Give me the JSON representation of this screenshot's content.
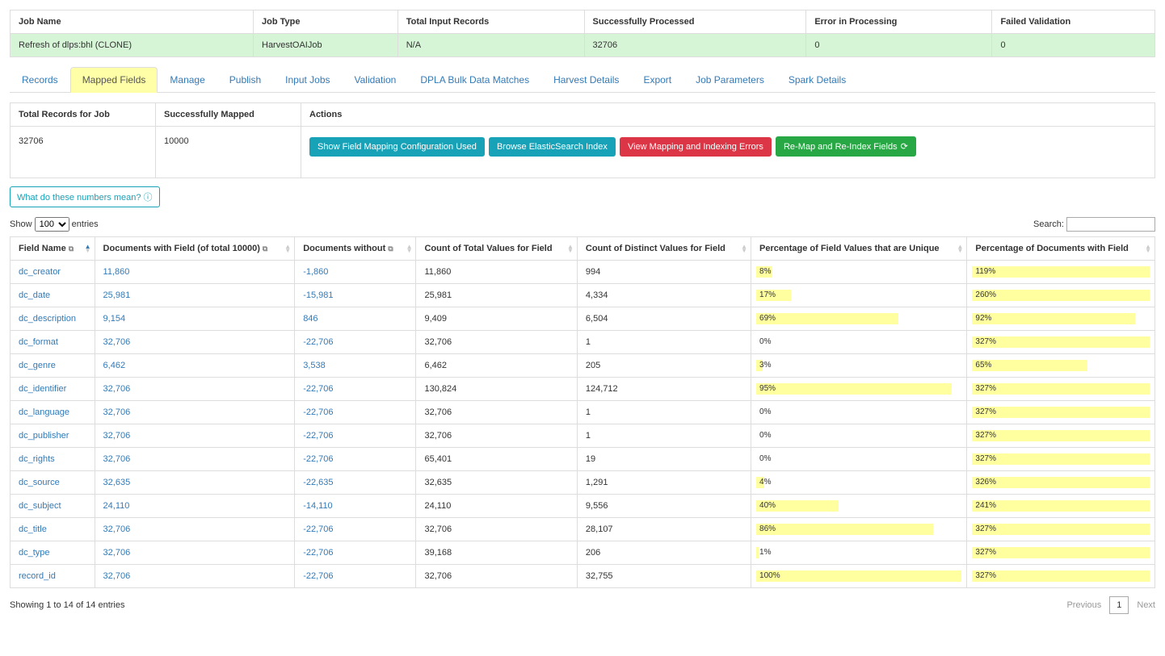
{
  "summary": {
    "headers": [
      "Job Name",
      "Job Type",
      "Total Input Records",
      "Successfully Processed",
      "Error in Processing",
      "Failed Validation"
    ],
    "row": [
      "Refresh of dlps:bhl (CLONE)",
      "HarvestOAIJob",
      "N/A",
      "32706",
      "0",
      "0"
    ]
  },
  "tabs": [
    "Records",
    "Mapped Fields",
    "Manage",
    "Publish",
    "Input Jobs",
    "Validation",
    "DPLA Bulk Data Matches",
    "Harvest Details",
    "Export",
    "Job Parameters",
    "Spark Details"
  ],
  "active_tab": "Mapped Fields",
  "info": {
    "headers": [
      "Total Records for Job",
      "Successfully Mapped",
      "Actions"
    ],
    "total_records": "32706",
    "successfully_mapped": "10000",
    "actions": {
      "show_config": "Show Field Mapping Configuration Used",
      "browse_es": "Browse ElasticSearch Index",
      "view_errors": "View Mapping and Indexing Errors",
      "remap": "Re-Map and Re-Index Fields"
    }
  },
  "help_label": "What do these numbers mean?",
  "show_label_pre": "Show",
  "show_label_post": "entries",
  "show_value": "100",
  "search_label": "Search:",
  "search_value": "",
  "dt": {
    "headers": [
      "Field Name",
      "Documents with Field (of total 10000)",
      "Documents without",
      "Count of Total Values for Field",
      "Count of Distinct Values for Field",
      "Percentage of Field Values that are Unique",
      "Percentage of Documents with Field"
    ],
    "rows": [
      {
        "field": "dc_creator",
        "with": "11,860",
        "without": "-1,860",
        "total": "11,860",
        "distinct": "994",
        "uniq_pct": "8%",
        "uniq_w": 8,
        "docs_pct": "119%",
        "docs_w": 100
      },
      {
        "field": "dc_date",
        "with": "25,981",
        "without": "-15,981",
        "total": "25,981",
        "distinct": "4,334",
        "uniq_pct": "17%",
        "uniq_w": 17,
        "docs_pct": "260%",
        "docs_w": 100
      },
      {
        "field": "dc_description",
        "with": "9,154",
        "without": "846",
        "total": "9,409",
        "distinct": "6,504",
        "uniq_pct": "69%",
        "uniq_w": 69,
        "docs_pct": "92%",
        "docs_w": 92
      },
      {
        "field": "dc_format",
        "with": "32,706",
        "without": "-22,706",
        "total": "32,706",
        "distinct": "1",
        "uniq_pct": "0%",
        "uniq_w": 0,
        "docs_pct": "327%",
        "docs_w": 100
      },
      {
        "field": "dc_genre",
        "with": "6,462",
        "without": "3,538",
        "total": "6,462",
        "distinct": "205",
        "uniq_pct": "3%",
        "uniq_w": 3,
        "docs_pct": "65%",
        "docs_w": 65
      },
      {
        "field": "dc_identifier",
        "with": "32,706",
        "without": "-22,706",
        "total": "130,824",
        "distinct": "124,712",
        "uniq_pct": "95%",
        "uniq_w": 95,
        "docs_pct": "327%",
        "docs_w": 100
      },
      {
        "field": "dc_language",
        "with": "32,706",
        "without": "-22,706",
        "total": "32,706",
        "distinct": "1",
        "uniq_pct": "0%",
        "uniq_w": 0,
        "docs_pct": "327%",
        "docs_w": 100
      },
      {
        "field": "dc_publisher",
        "with": "32,706",
        "without": "-22,706",
        "total": "32,706",
        "distinct": "1",
        "uniq_pct": "0%",
        "uniq_w": 0,
        "docs_pct": "327%",
        "docs_w": 100
      },
      {
        "field": "dc_rights",
        "with": "32,706",
        "without": "-22,706",
        "total": "65,401",
        "distinct": "19",
        "uniq_pct": "0%",
        "uniq_w": 0,
        "docs_pct": "327%",
        "docs_w": 100
      },
      {
        "field": "dc_source",
        "with": "32,635",
        "without": "-22,635",
        "total": "32,635",
        "distinct": "1,291",
        "uniq_pct": "4%",
        "uniq_w": 4,
        "docs_pct": "326%",
        "docs_w": 100
      },
      {
        "field": "dc_subject",
        "with": "24,110",
        "without": "-14,110",
        "total": "24,110",
        "distinct": "9,556",
        "uniq_pct": "40%",
        "uniq_w": 40,
        "docs_pct": "241%",
        "docs_w": 100
      },
      {
        "field": "dc_title",
        "with": "32,706",
        "without": "-22,706",
        "total": "32,706",
        "distinct": "28,107",
        "uniq_pct": "86%",
        "uniq_w": 86,
        "docs_pct": "327%",
        "docs_w": 100
      },
      {
        "field": "dc_type",
        "with": "32,706",
        "without": "-22,706",
        "total": "39,168",
        "distinct": "206",
        "uniq_pct": "1%",
        "uniq_w": 1,
        "docs_pct": "327%",
        "docs_w": 100
      },
      {
        "field": "record_id",
        "with": "32,706",
        "without": "-22,706",
        "total": "32,706",
        "distinct": "32,755",
        "uniq_pct": "100%",
        "uniq_w": 100,
        "docs_pct": "327%",
        "docs_w": 100
      }
    ]
  },
  "footer": {
    "showing": "Showing 1 to 14 of 14 entries",
    "previous": "Previous",
    "page": "1",
    "next": "Next"
  }
}
